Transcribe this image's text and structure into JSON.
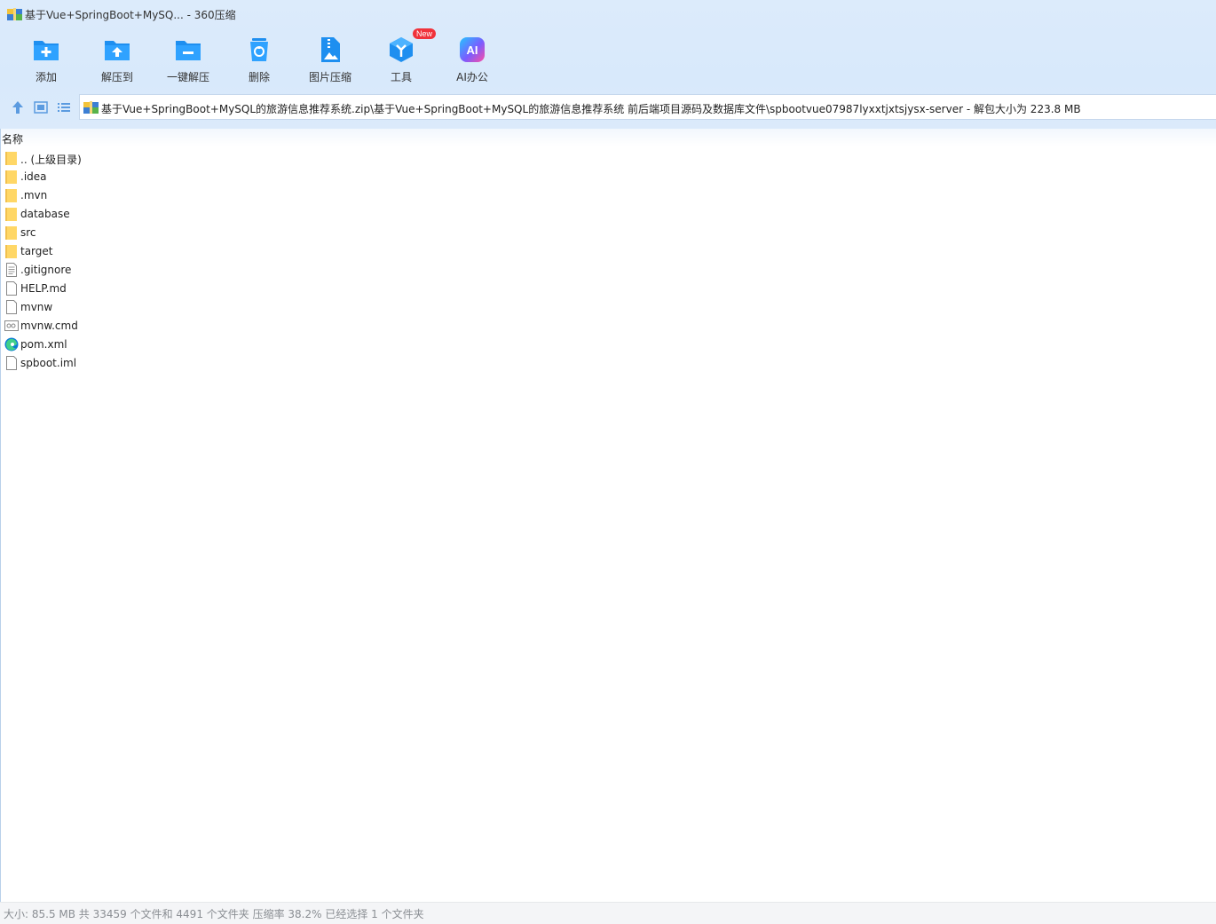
{
  "window": {
    "title": "基于Vue+SpringBoot+MySQ... - 360压缩"
  },
  "toolbar": {
    "buttons": [
      {
        "label": "添加",
        "icon": "add-folder-icon"
      },
      {
        "label": "解压到",
        "icon": "extract-to-icon"
      },
      {
        "label": "一键解压",
        "icon": "one-click-extract-icon"
      },
      {
        "label": "删除",
        "icon": "delete-bin-icon"
      },
      {
        "label": "图片压缩",
        "icon": "image-compress-icon"
      },
      {
        "label": "工具",
        "icon": "tools-cube-icon",
        "badge": "New"
      },
      {
        "label": "AI办公",
        "icon": "ai-office-icon"
      }
    ]
  },
  "nav": {
    "path": "基于Vue+SpringBoot+MySQL的旅游信息推荐系统.zip\\基于Vue+SpringBoot+MySQL的旅游信息推荐系统 前后端项目源码及数据库文件\\spbootvue07987lyxxtjxtsjysx-server - 解包大小为 223.8 MB"
  },
  "list": {
    "column_name": "名称",
    "items": [
      {
        "name": ".. (上级目录)",
        "type": "folder"
      },
      {
        "name": ".idea",
        "type": "folder"
      },
      {
        "name": ".mvn",
        "type": "folder"
      },
      {
        "name": "database",
        "type": "folder"
      },
      {
        "name": "src",
        "type": "folder"
      },
      {
        "name": "target",
        "type": "folder"
      },
      {
        "name": ".gitignore",
        "type": "text"
      },
      {
        "name": "HELP.md",
        "type": "file"
      },
      {
        "name": "mvnw",
        "type": "file"
      },
      {
        "name": "mvnw.cmd",
        "type": "cmd"
      },
      {
        "name": "pom.xml",
        "type": "edge"
      },
      {
        "name": "spboot.iml",
        "type": "file"
      }
    ]
  },
  "status": {
    "text": "大小: 85.5 MB 共 33459 个文件和 4491 个文件夹 压缩率 38.2% 已经选择 1 个文件夹"
  },
  "colors": {
    "toolbar_bg": "#dcebfb",
    "accent_blue": "#1e8ff0",
    "badge_red": "#f0323b",
    "folder_yellow": "#ffd766"
  }
}
